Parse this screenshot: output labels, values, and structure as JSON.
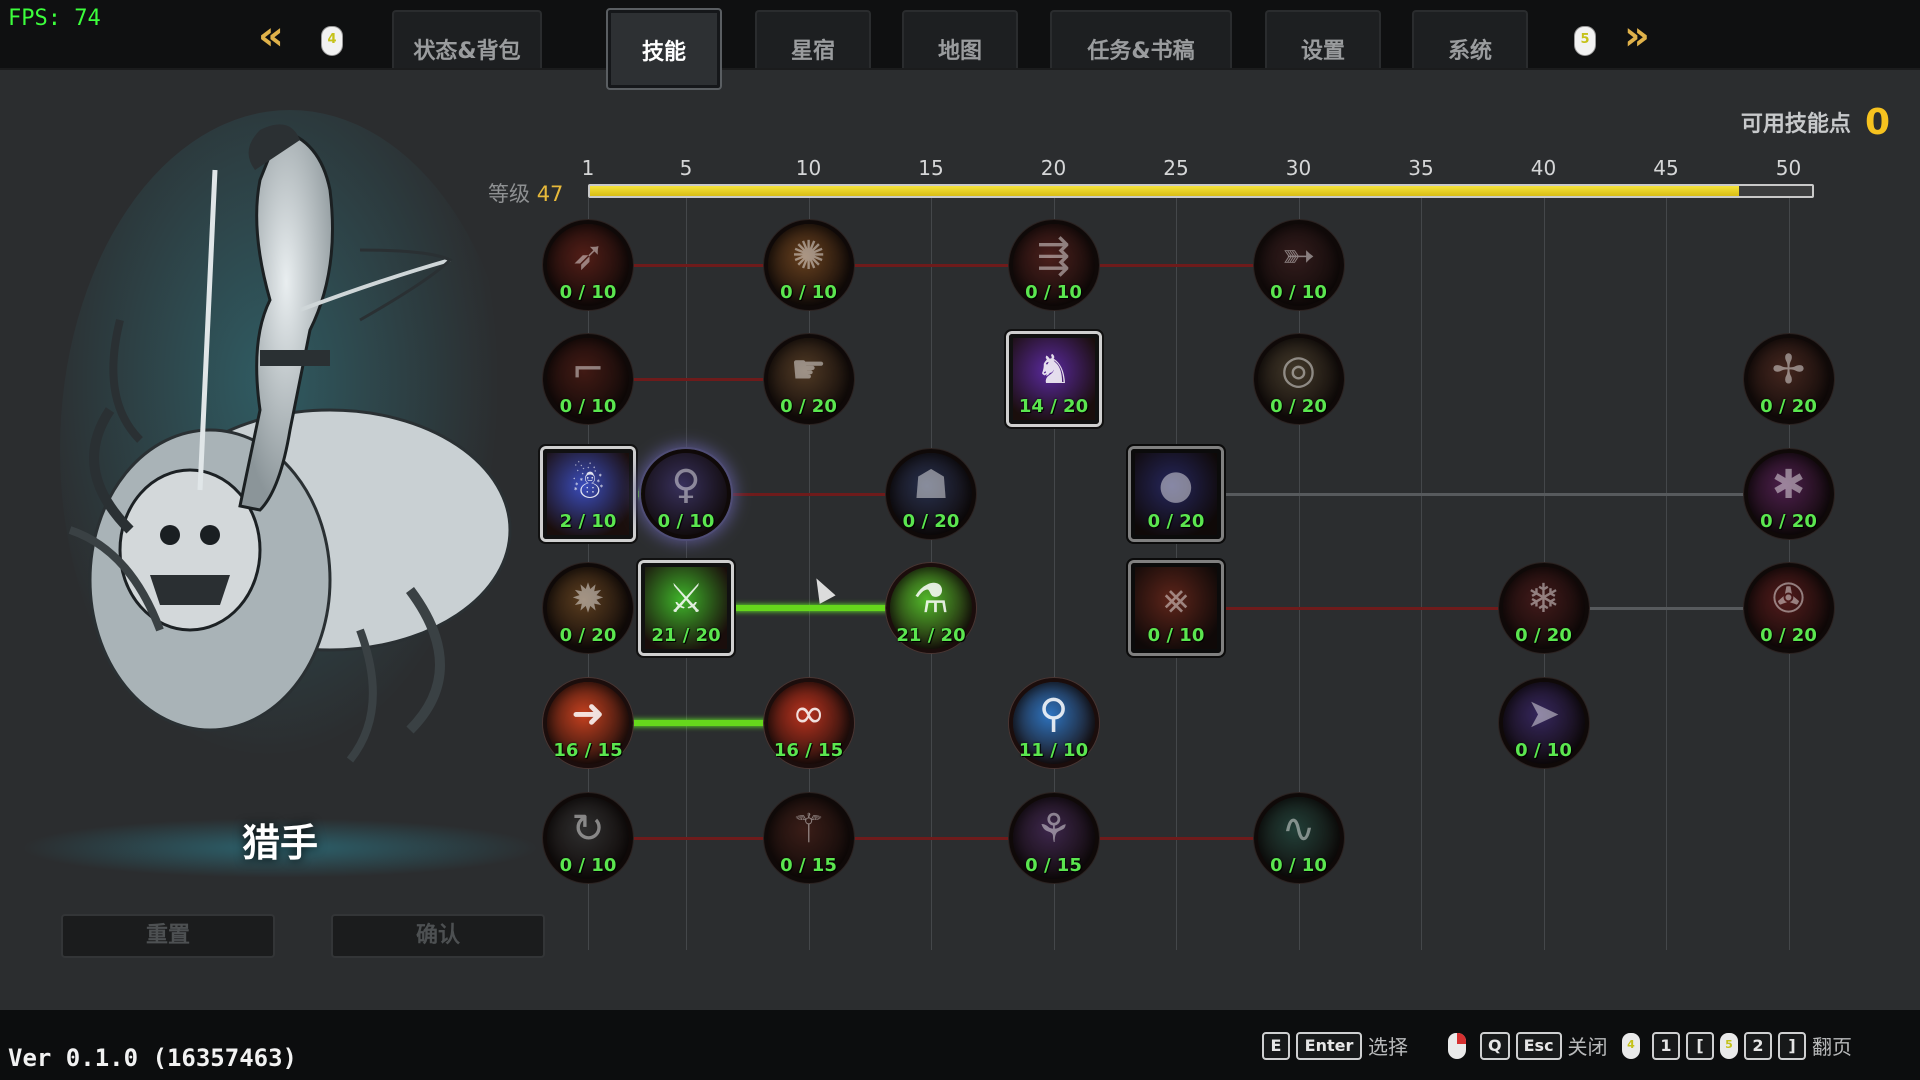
{
  "hud": {
    "fps": "FPS: 74",
    "version": "Ver 0.1.0 (16357463)"
  },
  "nav": {
    "prev_arrow": "«",
    "next_arrow": "»",
    "prev_key": "4",
    "next_key": "5",
    "tabs": [
      {
        "label": "状态&背包",
        "active": false
      },
      {
        "label": "技能",
        "active": true
      },
      {
        "label": "星宿",
        "active": false
      },
      {
        "label": "地图",
        "active": false
      },
      {
        "label": "任务&书稿",
        "active": false
      },
      {
        "label": "设置",
        "active": false
      },
      {
        "label": "系统",
        "active": false
      }
    ]
  },
  "skill_points": {
    "label": "可用技能点",
    "value": "0"
  },
  "level": {
    "label": "等级",
    "value": "47",
    "progress_fraction": 0.94,
    "ruler_ticks": [
      "1",
      "5",
      "10",
      "15",
      "20",
      "25",
      "30",
      "35",
      "40",
      "45",
      "50"
    ]
  },
  "character": {
    "class_name": "猎手"
  },
  "buttons": {
    "reset": "重置",
    "confirm": "确认"
  },
  "skills": [
    {
      "id": "bow-shot",
      "level": "0 / 10",
      "color": "#9b2a1c",
      "icon": "bow-icon"
    },
    {
      "id": "fire-arrow",
      "level": "0 / 10",
      "color": "#b8641b",
      "icon": "burst-arrow-icon"
    },
    {
      "id": "multi-arrow",
      "level": "0 / 10",
      "color": "#8a2d26",
      "icon": "spread-arrows-icon"
    },
    {
      "id": "piercing-arrow",
      "level": "0 / 10",
      "color": "#5a2a2a",
      "icon": "pierce-arrow-icon"
    },
    {
      "id": "musket",
      "level": "0 / 10",
      "color": "#7a2519",
      "icon": "musket-icon"
    },
    {
      "id": "pistol",
      "level": "0 / 20",
      "color": "#8a5a2d",
      "icon": "pistol-icon"
    },
    {
      "id": "shadow-hound",
      "level": "14 / 20",
      "color": "#5b2aa0",
      "icon": "hound-icon"
    },
    {
      "id": "target",
      "level": "0 / 20",
      "color": "#6e5a3a",
      "icon": "target-icon"
    },
    {
      "id": "crossbow",
      "level": "0 / 20",
      "color": "#7a3a2a",
      "icon": "crossbow-icon"
    },
    {
      "id": "scarecrow",
      "level": "2 / 10",
      "color": "#3b4dbd",
      "icon": "scarecrow-icon"
    },
    {
      "id": "spirit-aura",
      "level": "0 / 10",
      "color": "#5c4caa",
      "icon": "spirit-icon"
    },
    {
      "id": "ghost-summon",
      "level": "0 / 20",
      "color": "#3a4c8a",
      "icon": "ghost-icon"
    },
    {
      "id": "blue-orb",
      "level": "0 / 20",
      "color": "#3a3cb0",
      "icon": "orb-icon"
    },
    {
      "id": "purple-burst",
      "level": "0 / 20",
      "color": "#8c2a8c",
      "icon": "purple-burst-icon"
    },
    {
      "id": "explosive-trap",
      "level": "0 / 20",
      "color": "#a0601f",
      "icon": "explosion-icon"
    },
    {
      "id": "poison-blade",
      "level": "21 / 20",
      "color": "#3fb42a",
      "icon": "blade-icon"
    },
    {
      "id": "poison-flask",
      "level": "21 / 20",
      "color": "#52b82a",
      "icon": "flask-icon"
    },
    {
      "id": "bear-trap",
      "level": "0 / 10",
      "color": "#b0351e",
      "icon": "bear-trap-icon"
    },
    {
      "id": "frost-trap",
      "level": "0 / 20",
      "color": "#7a2525",
      "icon": "snowflake-icon"
    },
    {
      "id": "cluster-trap",
      "level": "0 / 20",
      "color": "#9a2525",
      "icon": "cluster-icon"
    },
    {
      "id": "chain-hook",
      "level": "16 / 15",
      "color": "#c4401f",
      "icon": "hook-runner-icon"
    },
    {
      "id": "chain-whip",
      "level": "16 / 15",
      "color": "#b8321e",
      "icon": "chain-icon"
    },
    {
      "id": "fleet-foot",
      "level": "11 / 10",
      "color": "#2e74c0",
      "icon": "legs-icon"
    },
    {
      "id": "shadow-step",
      "level": "0 / 10",
      "color": "#5a3ab0",
      "icon": "dash-icon"
    },
    {
      "id": "boomerang",
      "level": "0 / 10",
      "color": "#4a4a4a",
      "icon": "boomerang-icon"
    },
    {
      "id": "throwing-knives",
      "level": "0 / 15",
      "color": "#6a2c20",
      "icon": "knives-icon"
    },
    {
      "id": "dodge-roll",
      "level": "0 / 15",
      "color": "#6a3a8a",
      "icon": "acrobat-icon"
    },
    {
      "id": "whip-lash",
      "level": "0 / 10",
      "color": "#2a6a5a",
      "icon": "whip-icon"
    }
  ],
  "hints": {
    "select_key_e": "E",
    "select_key_enter": "Enter",
    "select_label": "选择",
    "close_key_q": "Q",
    "close_key_esc": "Esc",
    "close_label": "关闭",
    "page_mouse_left": "4",
    "page_key_1": "1",
    "page_key_lbr": "[",
    "page_mouse_right": "5",
    "page_key_2": "2",
    "page_key_rbr": "]",
    "page_label": "翻页"
  }
}
